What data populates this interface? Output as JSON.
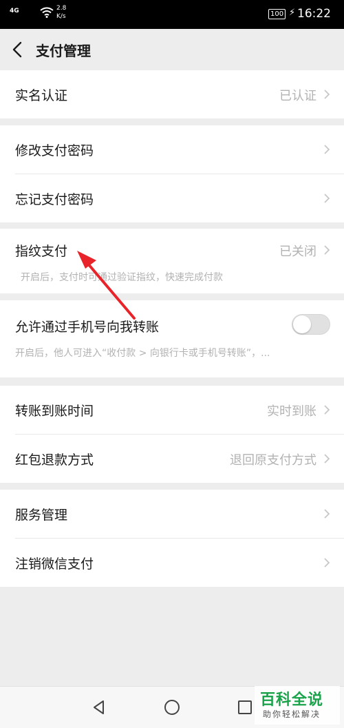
{
  "status_bar": {
    "network": "4G",
    "speed_value": "2.8",
    "speed_unit": "K/s",
    "battery": "100",
    "time": "16:22"
  },
  "header": {
    "title": "支付管理"
  },
  "sections": {
    "realname": {
      "label": "实名认证",
      "value": "已认证"
    },
    "modify_password": {
      "label": "修改支付密码"
    },
    "forgot_password": {
      "label": "忘记支付密码"
    },
    "fingerprint": {
      "label": "指纹支付",
      "value": "已关闭",
      "description": "开启后，支付时可通过验证指纹，快速完成付款"
    },
    "phone_transfer": {
      "label": "允许通过手机号向我转账",
      "description": "开启后，他人可进入“收付款 > 向银行卡或手机号转账”，...",
      "enabled": false
    },
    "transfer_time": {
      "label": "转账到账时间",
      "value": "实时到账"
    },
    "red_packet_refund": {
      "label": "红包退款方式",
      "value": "退回原支付方式"
    },
    "service_management": {
      "label": "服务管理"
    },
    "cancel_wechat_pay": {
      "label": "注销微信支付"
    }
  },
  "watermark": {
    "title": "百科全说",
    "subtitle": "助你轻松解决"
  },
  "colors": {
    "background": "#ededed",
    "card": "#ffffff",
    "secondary_text": "#b2b2b2",
    "annotation_arrow": "#e8232a",
    "watermark_green": "#1aa34a"
  },
  "icons": {
    "back": "back-icon",
    "chevron": "chevron-right-icon",
    "nav_back": "triangle-back-icon",
    "nav_home": "circle-home-icon",
    "nav_recent": "square-recent-icon"
  }
}
